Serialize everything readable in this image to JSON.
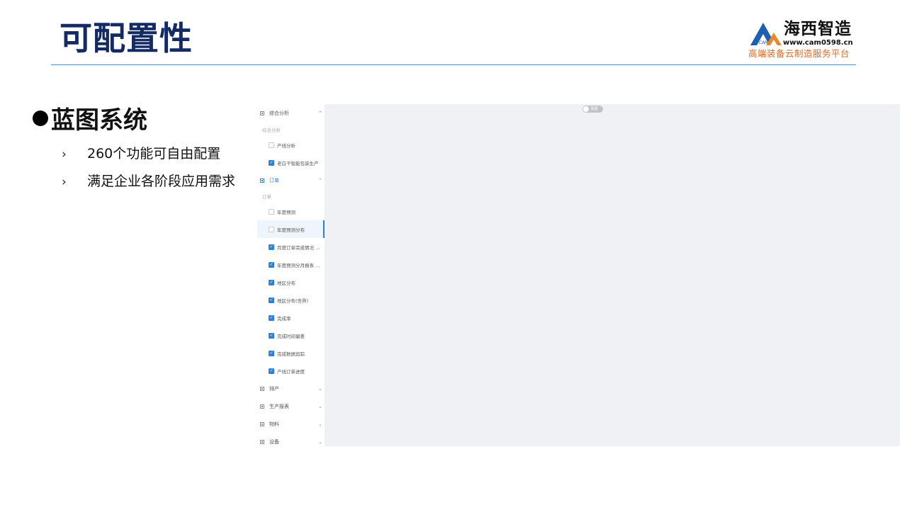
{
  "slide": {
    "title": "可配置性"
  },
  "logo": {
    "name": "海西智造",
    "mark_text": "CAM",
    "url": "www.cam0598.cn",
    "slogan": "高端装备云制造服务平台",
    "colors": {
      "blue": "#1d5fb0",
      "orange": "#e8882b"
    }
  },
  "bullets": {
    "heading": "蓝图系统",
    "items": [
      {
        "marker": "›",
        "text": "260个功能可自由配置"
      },
      {
        "marker": "›",
        "text": "满足企业各阶段应用需求"
      }
    ]
  },
  "app": {
    "toggle_label": "配置",
    "sidebar": {
      "groups": [
        {
          "label": "综合分析",
          "caret": "⌃",
          "expanded": true,
          "sub_label": "综合分析",
          "items": [
            {
              "label": "产线分析",
              "checked": false
            },
            {
              "label": "老白干智能包装生产",
              "checked": true
            }
          ]
        },
        {
          "label": "订单",
          "caret": "⌃",
          "expanded": true,
          "active": true,
          "sub_label": "订单",
          "items": [
            {
              "label": "年度预测",
              "checked": false
            },
            {
              "label": "年度预测分布",
              "checked": false,
              "selected": true
            },
            {
              "label": "月度订单完成情况 …",
              "checked": true
            },
            {
              "label": "年度预测分月报表 …",
              "checked": true
            },
            {
              "label": "地区分布",
              "checked": true
            },
            {
              "label": "地区分布(世界)",
              "checked": true
            },
            {
              "label": "完成率",
              "checked": true
            },
            {
              "label": "完成时间偏差",
              "checked": true
            },
            {
              "label": "完成数据追踪",
              "checked": true
            },
            {
              "label": "产线订单进度",
              "checked": true
            }
          ]
        },
        {
          "label": "排产",
          "caret": "⌄",
          "expanded": false
        },
        {
          "label": "生产报表",
          "caret": "⌄",
          "expanded": false
        },
        {
          "label": "物料",
          "caret": "⌄",
          "expanded": false
        },
        {
          "label": "设备",
          "caret": "⌄",
          "expanded": false
        }
      ]
    }
  }
}
